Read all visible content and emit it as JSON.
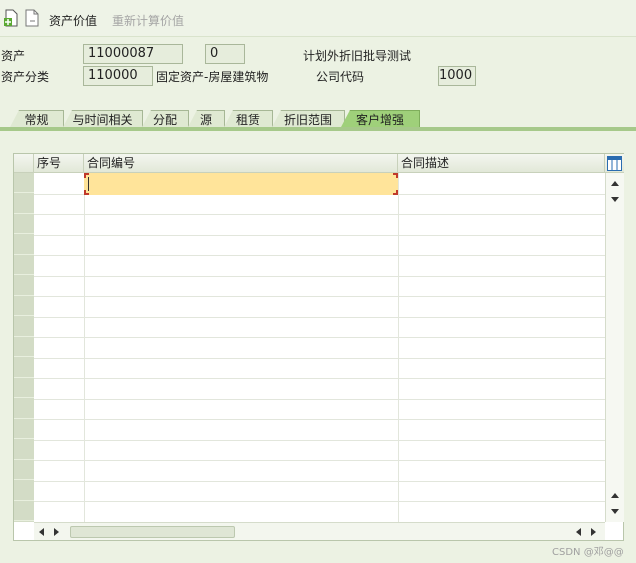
{
  "toolbar": {
    "asset_value": "资产价值",
    "recalculate_value": "重新计算价值"
  },
  "header": {
    "asset_label": "资产",
    "asset_number": "11000087",
    "asset_subnumber": "0",
    "asset_description": "计划外折旧批导测试",
    "asset_class_label": "资产分类",
    "asset_class": "110000",
    "asset_class_desc": "固定资产-房屋建筑物",
    "company_code_label": "公司代码",
    "company_code": "1000"
  },
  "tabs": [
    "常规",
    "与时间相关",
    "分配",
    "源",
    "租赁",
    "折旧范围",
    "客户增强"
  ],
  "active_tab": "客户增强",
  "table": {
    "columns": [
      "序号",
      "合同编号",
      "合同描述"
    ],
    "visible_rows": 17,
    "selected_cell": {
      "row": 0,
      "column": "合同编号"
    }
  },
  "watermark": "CSDN @邓@@"
}
